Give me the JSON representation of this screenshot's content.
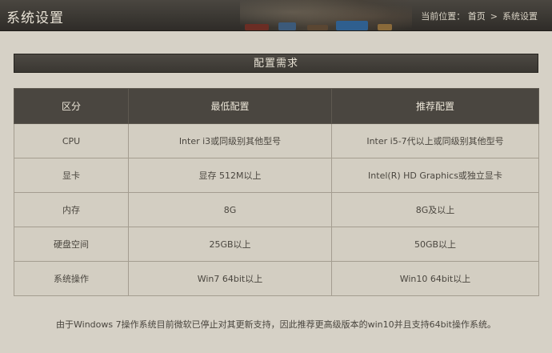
{
  "header": {
    "title": "系统设置",
    "breadcrumb_prefix": "当前位置：",
    "breadcrumb_home": "首页",
    "breadcrumb_sep": ">",
    "breadcrumb_current": "系统设置"
  },
  "section": {
    "title": "配置需求"
  },
  "table": {
    "headers": [
      "区分",
      "最低配置",
      "推荐配置"
    ],
    "rows": [
      [
        "CPU",
        "Inter i3或同级别其他型号",
        "Inter i5-7代以上或同级别其他型号"
      ],
      [
        "显卡",
        "显存 512M以上",
        "Intel(R) HD Graphics或独立显卡"
      ],
      [
        "内存",
        "8G",
        "8G及以上"
      ],
      [
        "硬盘空间",
        "25GB以上",
        "50GB以上"
      ],
      [
        "系统操作",
        "Win7 64bit以上",
        "Win10 64bit以上"
      ]
    ]
  },
  "footnote": "由于Windows 7操作系统目前微软已停止对其更新支持，因此推荐更高级版本的win10并且支持64bit操作系统。"
}
